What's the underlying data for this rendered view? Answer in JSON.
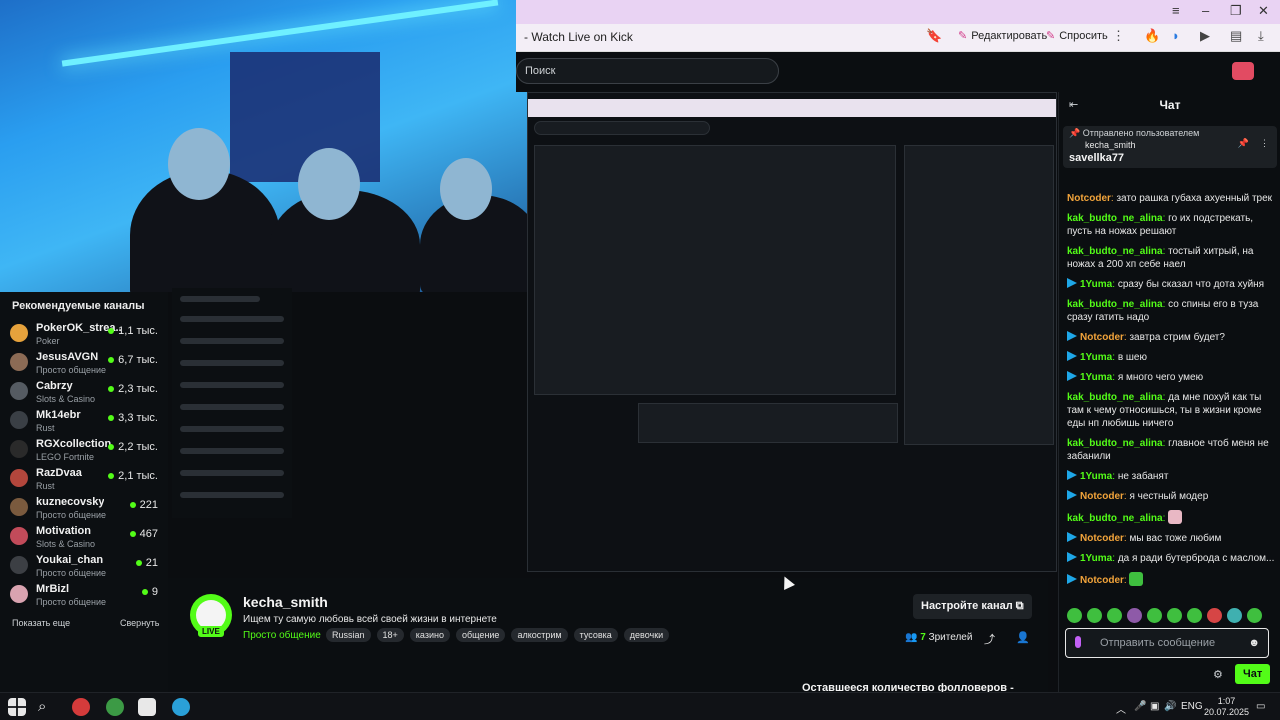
{
  "browser": {
    "tab_title": "- Watch Live on Kick",
    "edit_label": "Редактировать",
    "ask_label": "Спросить"
  },
  "kick": {
    "search_placeholder": "Поиск"
  },
  "sidebar": {
    "title": "Рекомендуемые каналы",
    "channels": [
      {
        "name": "PokerOK_strea...",
        "category": "Poker",
        "viewers": "1,1 тыс."
      },
      {
        "name": "JesusAVGN",
        "category": "Просто общение",
        "viewers": "6,7 тыс."
      },
      {
        "name": "Cabrzy",
        "category": "Slots & Casino",
        "viewers": "2,3 тыс."
      },
      {
        "name": "Mk14ebr",
        "category": "Rust",
        "viewers": "3,3 тыс."
      },
      {
        "name": "RGXcollection",
        "category": "LEGO Fortnite",
        "viewers": "2,2 тыс."
      },
      {
        "name": "RazDvaa",
        "category": "Rust",
        "viewers": "2,1 тыс."
      },
      {
        "name": "kuznecovsky",
        "category": "Просто общение",
        "viewers": "221"
      },
      {
        "name": "Motivation",
        "category": "Slots & Casino",
        "viewers": "467"
      },
      {
        "name": "Youkai_chan",
        "category": "Просто общение",
        "viewers": "21"
      },
      {
        "name": "MrBizl",
        "category": "Просто общение",
        "viewers": "9"
      }
    ],
    "show_more": "Показать еще",
    "collapse": "Свернуть"
  },
  "channel": {
    "name": "kecha_smith",
    "live": "LIVE",
    "description": "Ищем ту самую любовь всей своей жизни в интернете",
    "category": "Просто общение",
    "tags": [
      "Russian",
      "18+",
      "казино",
      "общение",
      "алкострим",
      "тусовка",
      "девочки"
    ],
    "follow_label": "Настройте канал",
    "viewers_count": "7",
    "viewers_label": "Зрителей",
    "followers_left": "Оставшееся количество фолловеров -"
  },
  "chat": {
    "title": "Чат",
    "pinned_label": "Отправлено пользователем",
    "pinned_user": "kecha_smith",
    "pinned_message": "savellka77",
    "messages": [
      {
        "user": "Notcoder",
        "color": "#f2a43b",
        "badge": false,
        "text": "зато рашка губаха ахуенный трек"
      },
      {
        "user": "kak_budto_ne_alina",
        "color": "#53fc18",
        "badge": false,
        "text": "го их подстрекать, пусть на ножах решают"
      },
      {
        "user": "kak_budto_ne_alina",
        "color": "#53fc18",
        "badge": false,
        "text": "тостый хитрый, на ножах а 200 хп себе наел"
      },
      {
        "user": "1Yuma",
        "color": "#53fc18",
        "badge": true,
        "text": "сразу бы сказал что дота хуйня"
      },
      {
        "user": "kak_budto_ne_alina",
        "color": "#53fc18",
        "badge": false,
        "text": "со спины его в туза сразу гатить надо"
      },
      {
        "user": "Notcoder",
        "color": "#f2a43b",
        "badge": true,
        "text": "завтра стрим будет?"
      },
      {
        "user": "1Yuma",
        "color": "#53fc18",
        "badge": true,
        "text": "в шею"
      },
      {
        "user": "1Yuma",
        "color": "#53fc18",
        "badge": true,
        "text": "я много чего умею"
      },
      {
        "user": "kak_budto_ne_alina",
        "color": "#53fc18",
        "badge": false,
        "text": "да мне похуй как ты там к чему относишься, ты в жизни кроме еды нп любишь ничего"
      },
      {
        "user": "kak_budto_ne_alina",
        "color": "#53fc18",
        "badge": false,
        "text": "главное чтоб меня не забанили"
      },
      {
        "user": "1Yuma",
        "color": "#53fc18",
        "badge": true,
        "text": "не забанят"
      },
      {
        "user": "Notcoder",
        "color": "#f2a43b",
        "badge": true,
        "text": "я честный модер"
      },
      {
        "user": "kak_budto_ne_alina",
        "color": "#53fc18",
        "badge": false,
        "text": ""
      },
      {
        "user": "Notcoder",
        "color": "#f2a43b",
        "badge": true,
        "text": "мы вас тоже любим"
      },
      {
        "user": "1Yuma",
        "color": "#53fc18",
        "badge": true,
        "text": "да я ради бутерброда с маслом..."
      },
      {
        "user": "Notcoder",
        "color": "#f2a43b",
        "badge": true,
        "text": ""
      }
    ],
    "send_placeholder": "Отправить сообщение",
    "chat_button": "Чат"
  },
  "taskbar": {
    "lang": "ENG",
    "time": "1:07",
    "date": "20.07.2025"
  },
  "colors": {
    "accent": "#53fc18",
    "background": "#0b0e11"
  }
}
